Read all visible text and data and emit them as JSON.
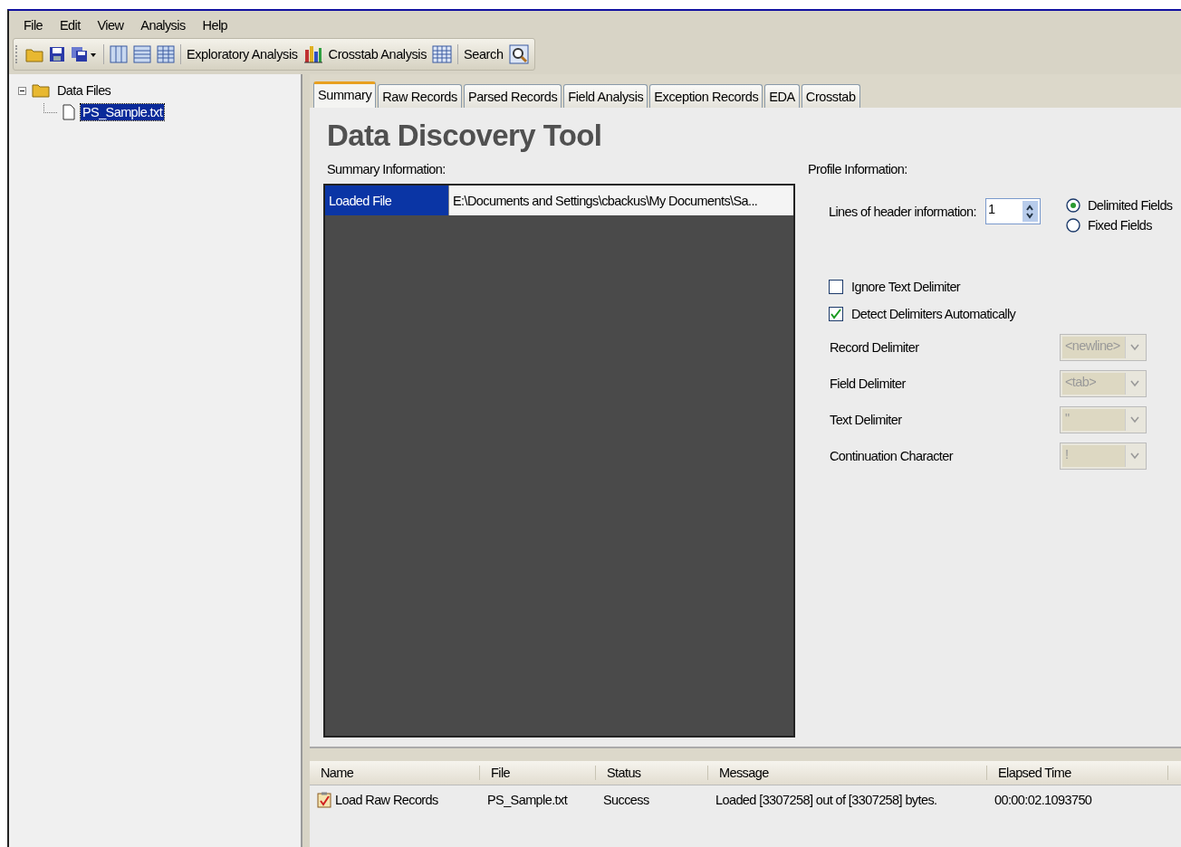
{
  "menu": [
    "File",
    "Edit",
    "View",
    "Analysis",
    "Help"
  ],
  "toolbar": {
    "text_buttons": [
      "Exploratory Analysis",
      "Crosstab Analysis",
      "Search"
    ]
  },
  "tree": {
    "label": "Data Files",
    "expanded": true,
    "children": [
      {
        "label": "PS_Sample.txt",
        "selected": true
      }
    ]
  },
  "tabs": [
    {
      "label": "Summary",
      "selected": true
    },
    {
      "label": "Raw Records",
      "selected": false
    },
    {
      "label": "Parsed Records",
      "selected": false
    },
    {
      "label": "Field Analysis",
      "selected": false
    },
    {
      "label": "Exception Records",
      "selected": false
    },
    {
      "label": "EDA",
      "selected": false
    },
    {
      "label": "Crosstab",
      "selected": false
    }
  ],
  "title": "Data Discovery Tool",
  "summary": {
    "label": "Summary Information:",
    "rows": [
      {
        "key": "Loaded File",
        "value": "E:\\Documents and Settings\\cbackus\\My Documents\\Sa...",
        "selected": true
      }
    ]
  },
  "profile": {
    "label": "Profile Information:",
    "header_lines": {
      "label": "Lines of header information:",
      "value": "1"
    },
    "radios": [
      {
        "label": "Delimited Fields",
        "selected": true
      },
      {
        "label": "Fixed Fields",
        "selected": false
      }
    ],
    "checkboxes": [
      {
        "label": "Ignore Text Delimiter",
        "checked": false
      },
      {
        "label": "Detect Delimiters Automatically",
        "checked": true
      }
    ],
    "dropdowns": [
      {
        "label": "Record Delimiter",
        "value": "<newline>",
        "disabled": true
      },
      {
        "label": "Field Delimiter",
        "value": "<tab>",
        "disabled": true
      },
      {
        "label": "Text Delimiter",
        "value": "\"",
        "disabled": true
      },
      {
        "label": "Continuation Character",
        "value": "!",
        "disabled": true
      }
    ]
  },
  "log": {
    "columns": [
      "Name",
      "File",
      "Status",
      "Message",
      "Elapsed Time"
    ],
    "rows": [
      {
        "cells": [
          "Load Raw Records",
          "PS_Sample.txt",
          "Success",
          "Loaded [3307258] out of [3307258] bytes.",
          "00:00:02.1093750"
        ]
      }
    ]
  }
}
